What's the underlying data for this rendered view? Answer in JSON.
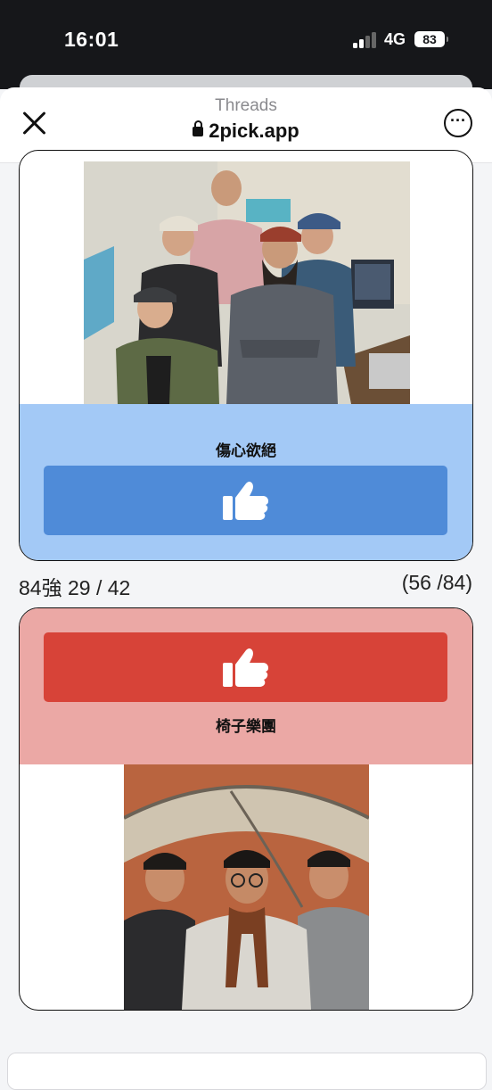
{
  "status_bar": {
    "time": "16:01",
    "network": "4G",
    "battery": "83"
  },
  "browser": {
    "source_title": "Threads",
    "url": "2pick.app"
  },
  "match": {
    "top_candidate": {
      "name": "傷心欲絕",
      "accent": "#4f8bd8",
      "panel": "#a3c9f6"
    },
    "progress_left": "84強 29 / 42",
    "progress_right": "(56 /84)",
    "bottom_candidate": {
      "name": "椅子樂團",
      "accent": "#d74338",
      "panel": "#eba8a5"
    }
  },
  "icons": {
    "vote": "thumbs-up-icon",
    "close": "close-icon",
    "more": "more-icon",
    "lock": "lock-icon"
  }
}
